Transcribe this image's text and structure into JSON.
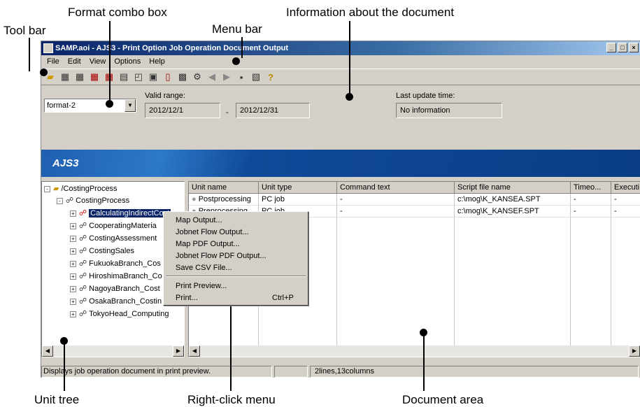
{
  "annotations": {
    "format_combo": "Format combo box",
    "info": "Information about the document",
    "toolbar": "Tool bar",
    "menubar": "Menu bar",
    "unit_tree": "Unit tree",
    "right_click": "Right-click menu",
    "doc_area": "Document area"
  },
  "window": {
    "title": "SAMP.aoi - AJS3 - Print Option Job Operation Document Output",
    "min": "_",
    "max": "□",
    "close": "×"
  },
  "menu": {
    "file": "File",
    "edit": "Edit",
    "view": "View",
    "options": "Options",
    "help": "Help"
  },
  "header": {
    "combo_value": "format-2",
    "valid_range_label": "Valid range:",
    "range_start": "2012/12/1",
    "range_sep": "-",
    "range_end": "2012/12/31",
    "last_update_label": "Last update time:",
    "last_update_value": "No information"
  },
  "banner": "AJS3",
  "tree": {
    "root": "/CostingProcess",
    "group": "CostingProcess",
    "items": [
      "CalculatingIndirectCost",
      "CooperatingMateria",
      "CostingAssessment",
      "CostingSales",
      "FukuokaBranch_Cos",
      "HiroshimaBranch_Co",
      "NagoyaBranch_Cost",
      "OsakaBranch_Costin",
      "TokyoHead_Computing"
    ]
  },
  "grid": {
    "headers": [
      "Unit name",
      "Unit type",
      "Command text",
      "Script file name",
      "Timeo...",
      "Executi"
    ],
    "rows": [
      [
        "Postprocessing",
        "PC job",
        "-",
        "c:\\mog\\K_KANSEA.SPT",
        "-",
        "-"
      ],
      [
        "Preprocessing",
        "PC job",
        "-",
        "c:\\mog\\K_KANSEF.SPT",
        "-",
        "-"
      ]
    ]
  },
  "context_menu": {
    "items": [
      "Map Output...",
      "Jobnet Flow Output...",
      "Map PDF Output...",
      "Jobnet Flow PDF Output...",
      "Save CSV File...",
      "Print Preview...",
      "Print..."
    ],
    "print_shortcut": "Ctrl+P"
  },
  "status": {
    "message": "Displays job operation document in print preview.",
    "size": "2lines,13columns"
  }
}
